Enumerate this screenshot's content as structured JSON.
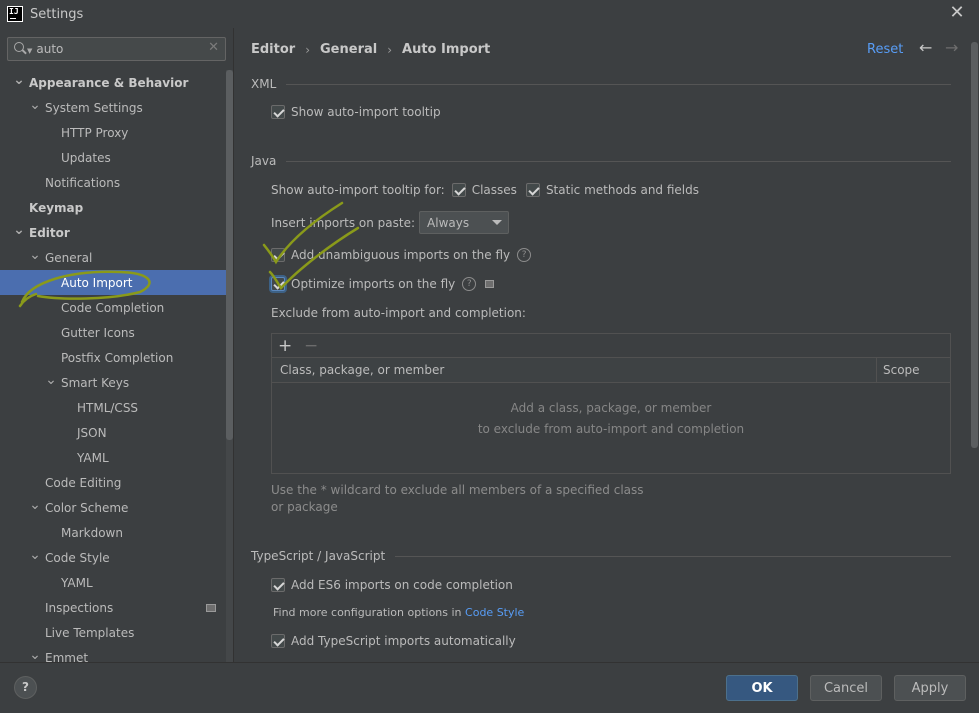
{
  "window": {
    "title": "Settings",
    "app_icon_text": "IJ"
  },
  "search": {
    "value": "auto",
    "clear": "✕"
  },
  "tree": [
    {
      "label": "Appearance & Behavior",
      "level": 0,
      "arrow": "v",
      "bold": true
    },
    {
      "label": "System Settings",
      "level": 1,
      "arrow": "v"
    },
    {
      "label": "HTTP Proxy",
      "level": 2,
      "arrow": ""
    },
    {
      "label": "Updates",
      "level": 2,
      "arrow": ""
    },
    {
      "label": "Notifications",
      "level": 1,
      "arrow": ""
    },
    {
      "label": "Keymap",
      "level": 0,
      "arrow": "",
      "bold": true
    },
    {
      "label": "Editor",
      "level": 0,
      "arrow": "v",
      "bold": true
    },
    {
      "label": "General",
      "level": 1,
      "arrow": "v"
    },
    {
      "label": "Auto Import",
      "level": 2,
      "arrow": "",
      "selected": true
    },
    {
      "label": "Code Completion",
      "level": 2,
      "arrow": ""
    },
    {
      "label": "Gutter Icons",
      "level": 2,
      "arrow": ""
    },
    {
      "label": "Postfix Completion",
      "level": 2,
      "arrow": ""
    },
    {
      "label": "Smart Keys",
      "level": 2,
      "arrow": "v"
    },
    {
      "label": "HTML/CSS",
      "level": 3,
      "arrow": ""
    },
    {
      "label": "JSON",
      "level": 3,
      "arrow": ""
    },
    {
      "label": "YAML",
      "level": 3,
      "arrow": ""
    },
    {
      "label": "Code Editing",
      "level": 1,
      "arrow": ""
    },
    {
      "label": "Color Scheme",
      "level": 1,
      "arrow": "v"
    },
    {
      "label": "Markdown",
      "level": 2,
      "arrow": ""
    },
    {
      "label": "Code Style",
      "level": 1,
      "arrow": "v"
    },
    {
      "label": "YAML",
      "level": 2,
      "arrow": ""
    },
    {
      "label": "Inspections",
      "level": 1,
      "arrow": "",
      "badge": true
    },
    {
      "label": "Live Templates",
      "level": 1,
      "arrow": ""
    },
    {
      "label": "Emmet",
      "level": 1,
      "arrow": "v"
    }
  ],
  "breadcrumb": {
    "items": [
      "Editor",
      "General",
      "Auto Import"
    ],
    "separator": "›"
  },
  "header": {
    "reset": "Reset",
    "back": "←",
    "forward": "→"
  },
  "xml": {
    "title": "XML",
    "show_tooltip": {
      "label": "Show auto-import tooltip",
      "checked": true
    }
  },
  "java": {
    "title": "Java",
    "tooltip_for_label": "Show auto-import tooltip for:",
    "classes": {
      "label": "Classes",
      "checked": true
    },
    "static_methods": {
      "label": "Static methods and fields",
      "checked": true
    },
    "insert_on_paste_label": "Insert imports on paste:",
    "insert_on_paste_value": "Always",
    "add_unambiguous": {
      "label": "Add unambiguous imports on the fly",
      "checked": true
    },
    "optimize": {
      "label": "Optimize imports on the fly",
      "checked": true
    },
    "help": "?",
    "exclude_label": "Exclude from auto-import and completion:",
    "table": {
      "add": "+",
      "remove": "−",
      "columns": [
        "Class, package, or member",
        "Scope"
      ],
      "empty_line1": "Add a class, package, or member",
      "empty_line2": "to exclude from auto-import and completion"
    },
    "hint": "Use the * wildcard to exclude all members of a specified class or package"
  },
  "typescript": {
    "title": "TypeScript / JavaScript",
    "add_es6": {
      "label": "Add ES6 imports on code completion",
      "checked": true
    },
    "more_options_prefix": "Find more configuration options in",
    "more_options_link": "Code Style",
    "add_ts": {
      "label": "Add TypeScript imports automatically",
      "checked": true
    }
  },
  "footer": {
    "help": "?",
    "ok": "OK",
    "cancel": "Cancel",
    "apply": "Apply"
  },
  "colors": {
    "accent": "#4b6eaf",
    "link": "#589df6",
    "annotation": "#8a9a1a",
    "background": "#3c3f41"
  }
}
